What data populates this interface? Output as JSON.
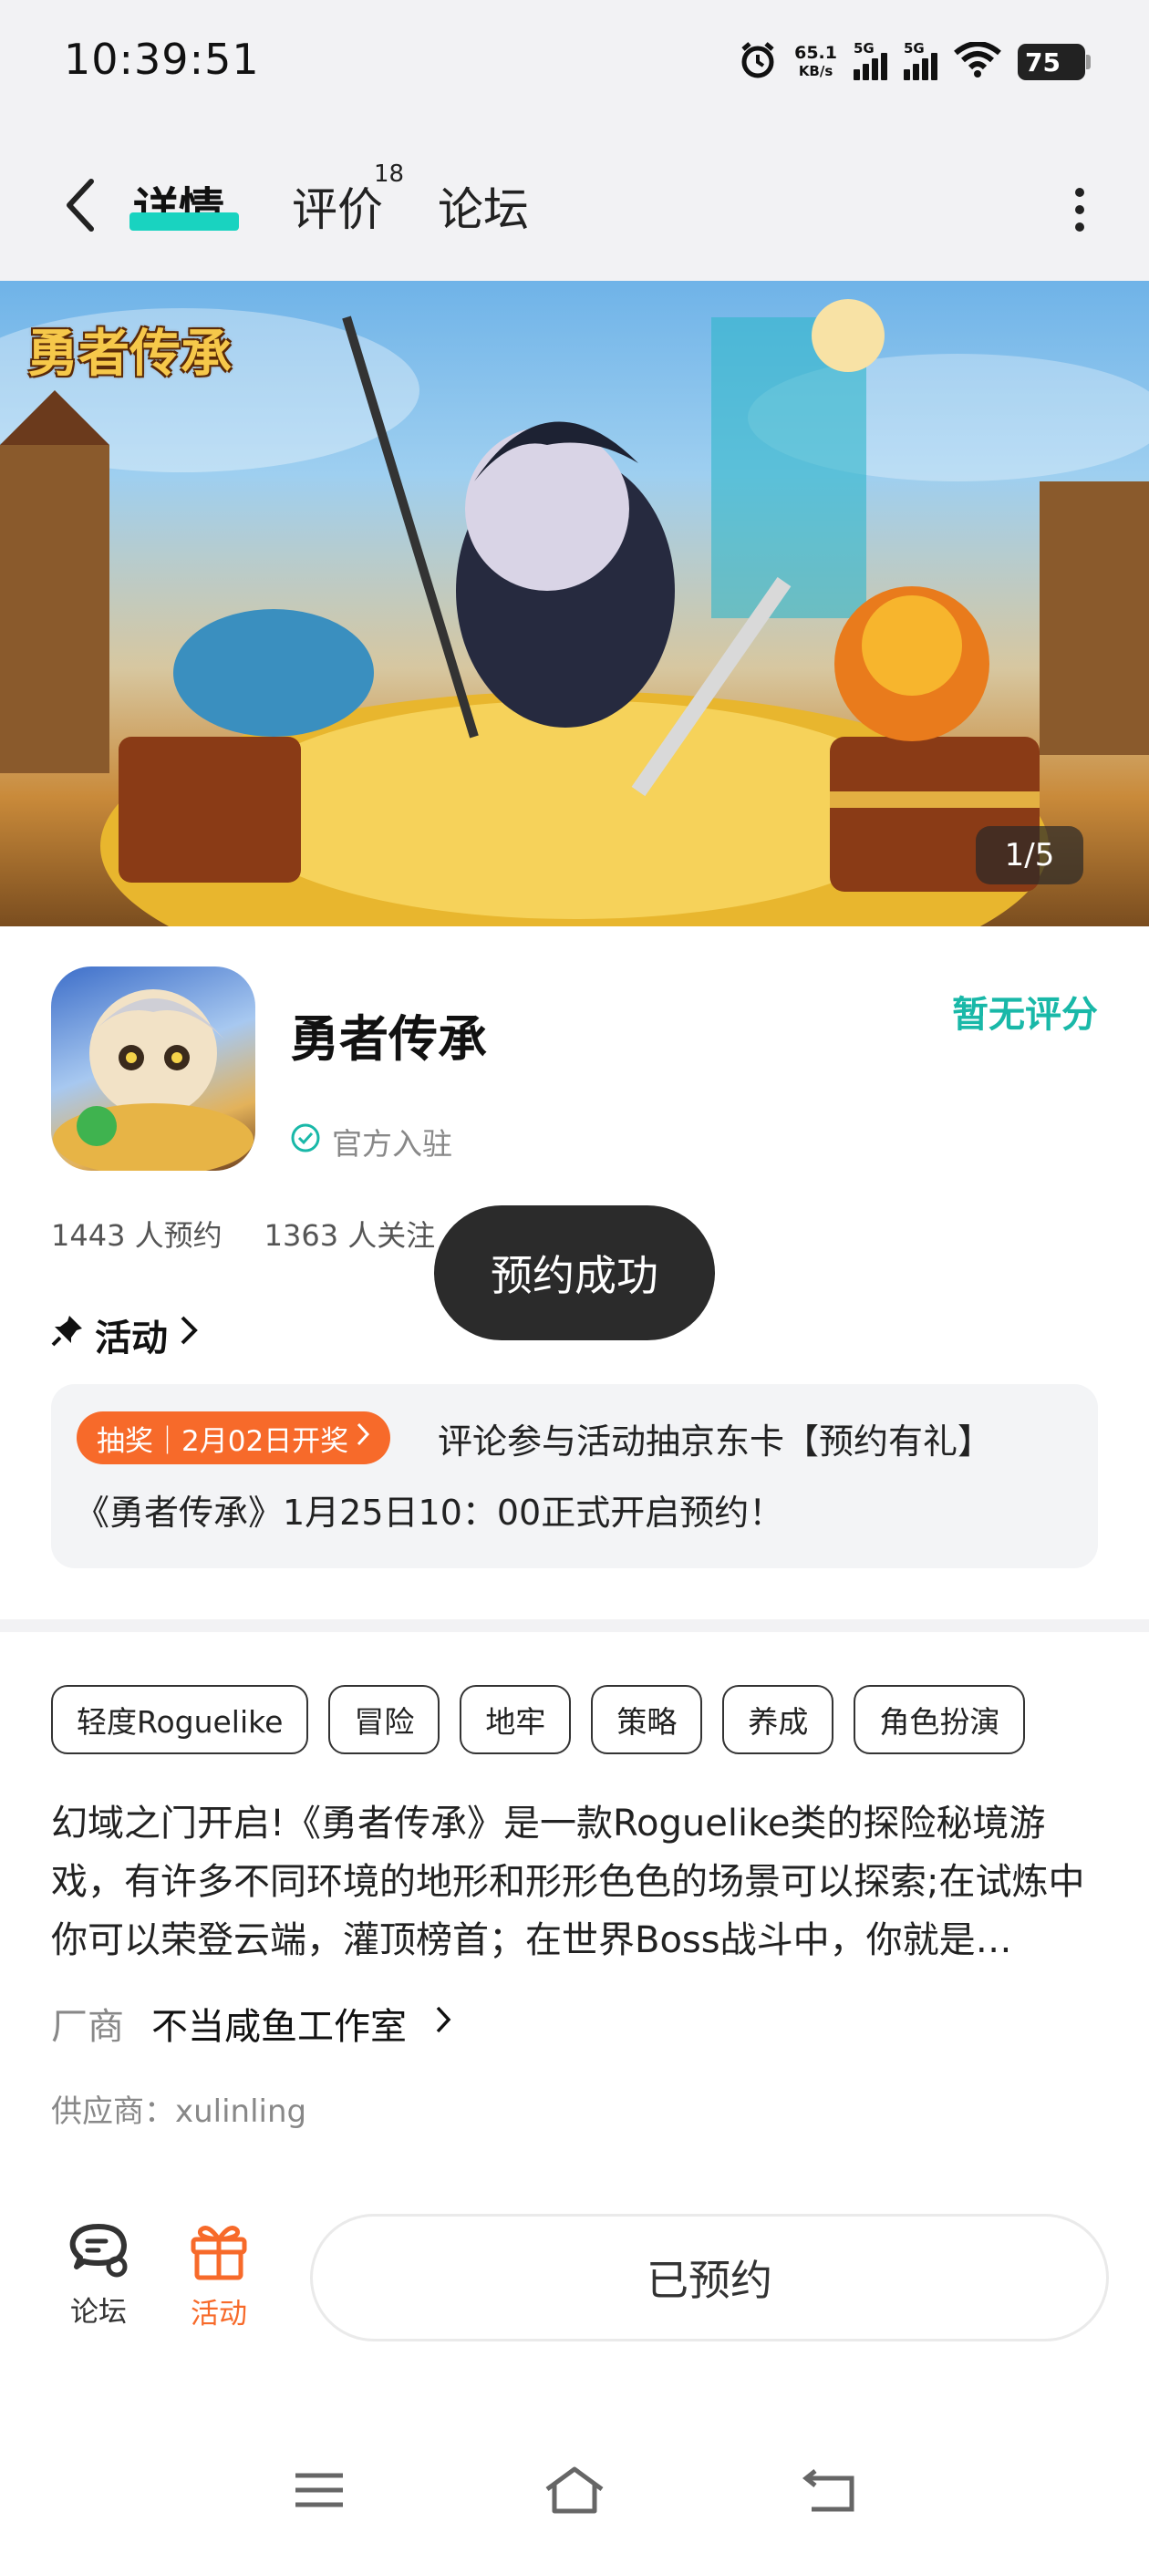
{
  "status_bar": {
    "time": "10:39:51",
    "net_speed_value": "65.1",
    "net_speed_unit": "KB/s",
    "signal1_label": "5G",
    "signal2_label": "5G",
    "battery": "75"
  },
  "header": {
    "tabs": [
      {
        "label": "详情",
        "active": true
      },
      {
        "label": "评价",
        "count": "18"
      },
      {
        "label": "论坛"
      }
    ]
  },
  "banner": {
    "logo_text": "勇者传承",
    "page_indicator": "1/5"
  },
  "app": {
    "name": "勇者传承",
    "official_label": "官方入驻",
    "rating": "暂无评分",
    "reservations": "1443 人预约",
    "followers": "1363 人关注"
  },
  "toast": "预约成功",
  "activity": {
    "heading": "活动",
    "badge": "抽奖｜2月02日开奖",
    "text_line1": "评论参与活动抽京东卡【预约有礼】",
    "text_line2": "《勇者传承》1月25日10：00正式开启预约！"
  },
  "tags": [
    "轻度Roguelike",
    "冒险",
    "地牢",
    "策略",
    "养成",
    "角色扮演"
  ],
  "description": "幻域之门开启!《勇者传承》是一款Roguelike类的探险秘境游戏，有许多不同环境的地形和形形色色的场景可以探索;在试炼中你可以荣登云端，灌顶榜首；在世界Boss战斗中，你就是…",
  "maker": {
    "label": "厂商",
    "value": "不当咸鱼工作室"
  },
  "supplier": "供应商：xulinling",
  "bottom_bar": {
    "forum_label": "论坛",
    "activity_label": "活动",
    "reserved_label": "已预约"
  },
  "colors": {
    "accent_teal": "#19d3c0",
    "rating_teal": "#19b8a8",
    "activity_orange": "#f76a2a",
    "toast_bg": "#2b2b2b"
  },
  "icons": [
    "back-arrow-icon",
    "more-vertical-icon",
    "check-circle-icon",
    "pin-icon",
    "chevron-right-icon",
    "chat-icon",
    "gift-icon",
    "menu-icon",
    "home-icon",
    "return-icon",
    "wifi-icon",
    "alarm-icon"
  ]
}
